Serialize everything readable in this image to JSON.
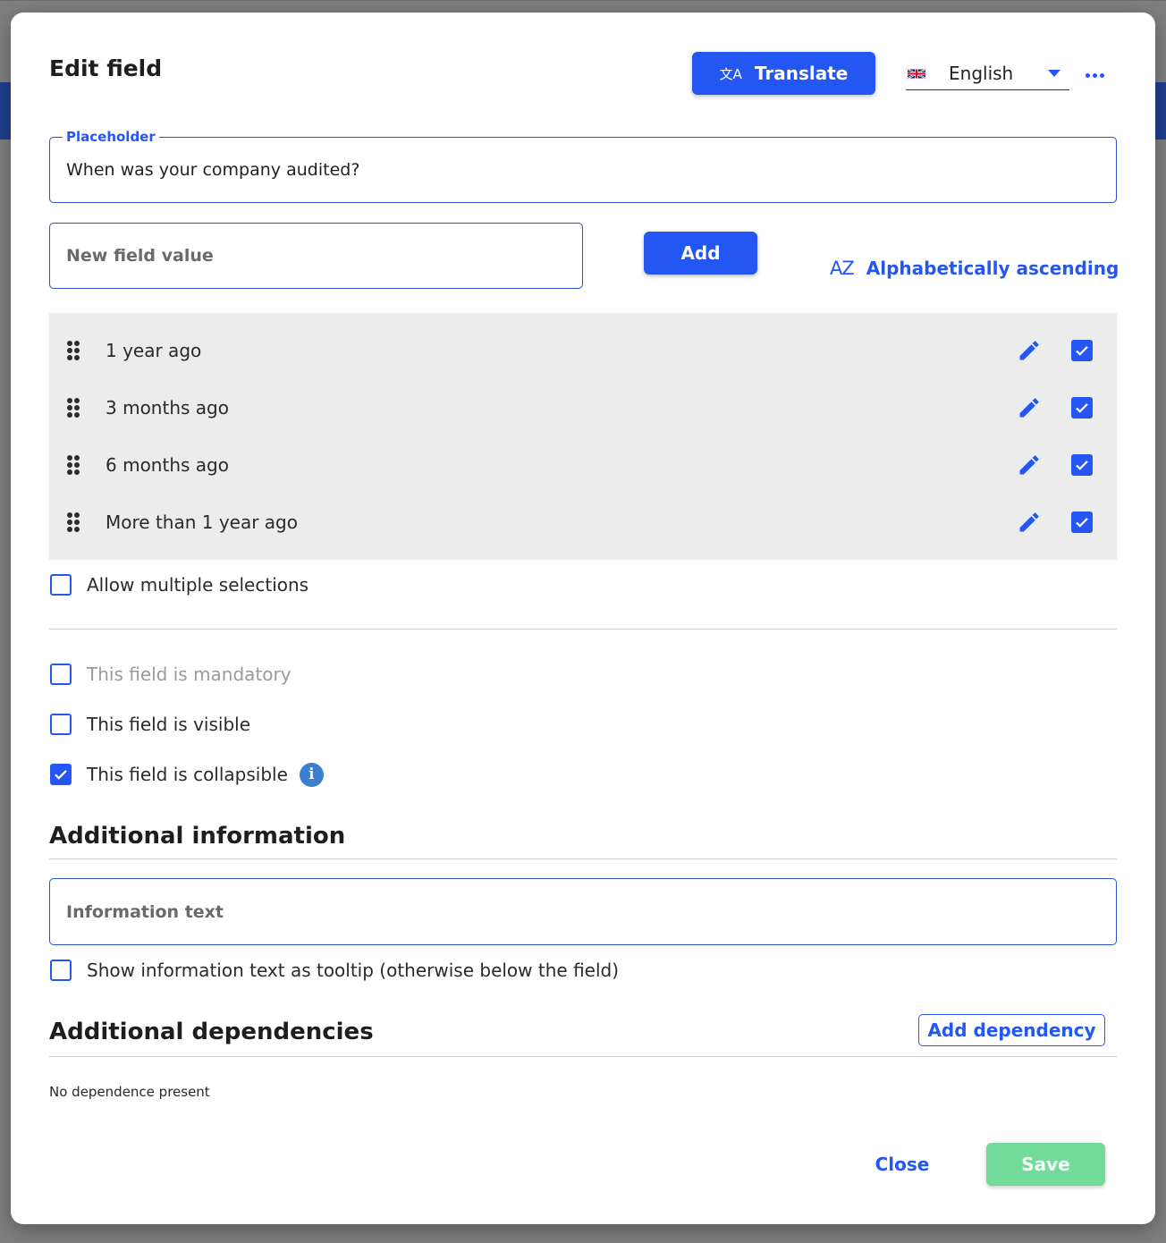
{
  "modal": {
    "title": "Edit field",
    "translate_label": "Translate",
    "language": "English"
  },
  "placeholder_field": {
    "label": "Placeholder",
    "value": "When was your company audited?"
  },
  "new_value_field": {
    "placeholder": "New field value"
  },
  "add_label": "Add",
  "sort_label": "Alphabetically ascending",
  "sort_icon_text": "AZ",
  "values": [
    {
      "label": "1 year ago",
      "checked": true
    },
    {
      "label": "3 months ago",
      "checked": true
    },
    {
      "label": "6 months ago",
      "checked": true
    },
    {
      "label": "More than 1 year ago",
      "checked": true
    }
  ],
  "options": {
    "allow_multiple": {
      "label": "Allow multiple selections",
      "checked": false
    },
    "mandatory": {
      "label": "This field is mandatory",
      "checked": false,
      "disabled": true
    },
    "visible": {
      "label": "This field is visible",
      "checked": false
    },
    "collapsible": {
      "label": "This field is collapsible",
      "checked": true
    }
  },
  "additional_information": {
    "title": "Additional information",
    "info_placeholder": "Information text",
    "tooltip_option": {
      "label": "Show information text as tooltip (otherwise below the field)",
      "checked": false
    }
  },
  "additional_dependencies": {
    "title": "Additional dependencies",
    "add_label": "Add dependency",
    "empty_text": "No dependence present"
  },
  "footer": {
    "close_label": "Close",
    "save_label": "Save"
  },
  "colors": {
    "accent": "#2456f4",
    "save_disabled": "#73db9a",
    "info": "#3c7fd0",
    "list_bg": "#ececec"
  }
}
